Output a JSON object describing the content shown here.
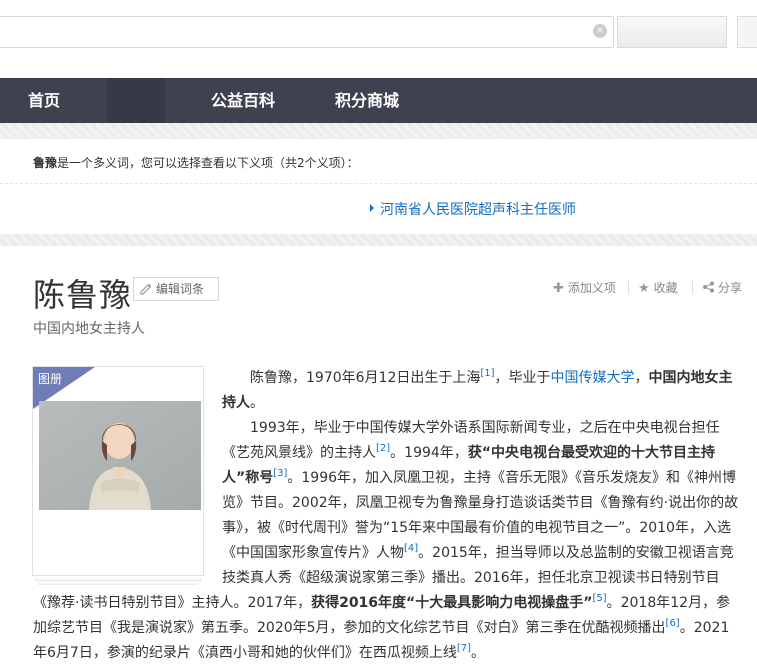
{
  "search": {
    "value": "",
    "clear_symbol": "×"
  },
  "nav": {
    "items": [
      "首页",
      "公益百科",
      "积分商城"
    ]
  },
  "polysemant": {
    "term": "鲁豫",
    "text": "是一个多义词，您可以选择查看以下义项（共2个义项）：",
    "link": "河南省人民医院超声科主任医师"
  },
  "entry": {
    "title": "陈鲁豫",
    "edit_label": "编辑词条",
    "subtitle": "中国内地女主持人",
    "actions": {
      "add": "添加义项",
      "favorite": "收藏",
      "share": "分享"
    }
  },
  "album": {
    "label": "图册"
  },
  "para1": {
    "t1": "陈鲁豫，1970年6月12日出生于上海",
    "ref1": "[1]",
    "t2": "，毕业于",
    "link1": "中国传媒大学",
    "t3": "，",
    "b1": "中国内地女主持人",
    "t4": "。"
  },
  "para2": {
    "t1": "1993年，毕业于中国传媒大学外语系国际新闻专业，之后在中央电视台担任《艺苑风景线》的主持人",
    "ref2": "[2]",
    "t2": "。1994年，",
    "b1": "获“中央电视台最受欢迎的十大节目主持人”称号",
    "ref3": "[3]",
    "t3": "。1996年，加入凤凰卫视，主持《音乐无限》《音乐发烧友》和《神州博览》节目。2002年，凤凰卫视专为鲁豫量身打造谈话类节目《鲁豫有约·说出你的故事》，被《时代周刊》誉为“15年来中国最有价值的电视节目之一”。2010年，入选《中国国家形象宣传片》人物",
    "ref4": "[4]",
    "t4": "。2015年，担当导师以及总监制的安徽卫视语言竞技类真人秀《超级演说家第三季》播出。2016年，担任北京卫视读书日特别节目《豫荐·读书日特别节目》主持人。2017年，",
    "b2": "获得2016年度“十大最具影响力电视操盘手”",
    "ref5": "[5]",
    "t5": "。2018年12月，参加综艺节目《我是演说家》第五季。2020年5月，参加的文化综艺节目《对白》第三季在优酷视频播出",
    "ref6": "[6]",
    "t6": "。2021年6月7日，参演的纪录片《滇西小哥和她的伙伴们》在西瓜视频上线",
    "ref7": "[7]",
    "t7": "。"
  },
  "colors": {
    "nav_bg": "#3f4150",
    "link": "#136ec2",
    "album_tag": "#6e7cb8"
  }
}
